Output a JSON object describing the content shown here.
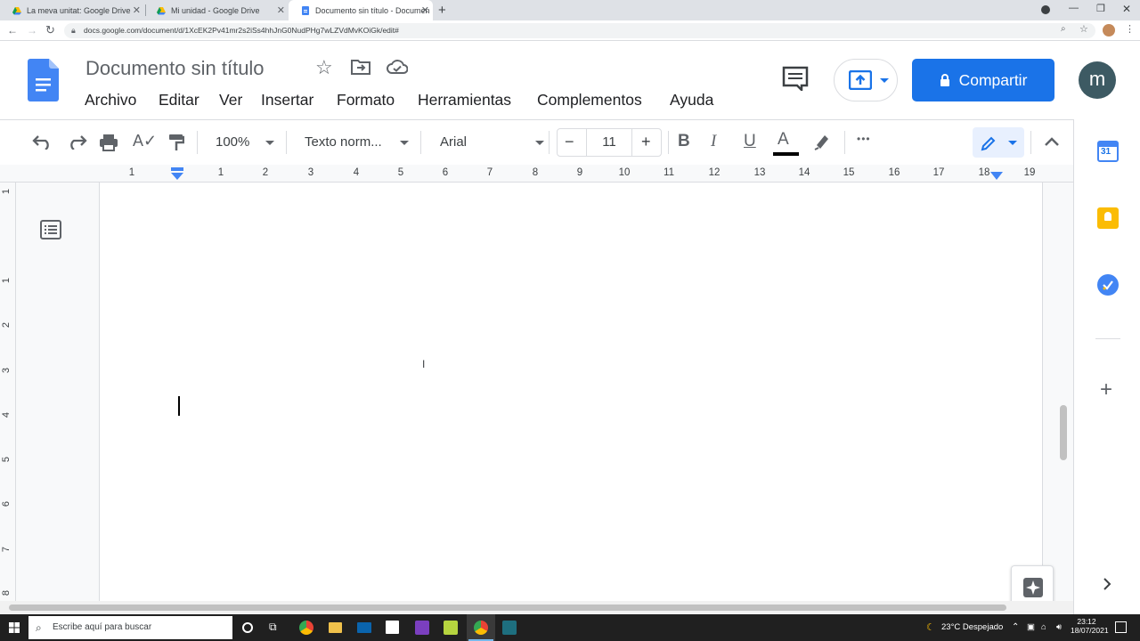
{
  "browser": {
    "tabs": [
      {
        "title": "La meva unitat: Google Drive"
      },
      {
        "title": "Mi unidad - Google Drive"
      },
      {
        "title": "Documento sin título - Documen"
      }
    ],
    "url": "docs.google.com/document/d/1XcEK2Pv41mr2s2iSs4hhJnG0NudPHg7wLZVdMvKOiGk/edit#"
  },
  "doc": {
    "title": "Documento sin título",
    "menu": [
      "Archivo",
      "Editar",
      "Ver",
      "Insertar",
      "Formato",
      "Herramientas",
      "Complementos",
      "Ayuda"
    ],
    "share_label": "Compartir",
    "avatar_letter": "m"
  },
  "toolbar": {
    "zoom": "100%",
    "style": "Texto norm...",
    "font": "Arial",
    "font_size": "11",
    "bold": "B",
    "italic": "I",
    "underline": "U",
    "text_color_letter": "A",
    "more": "•••"
  },
  "ruler": {
    "numbers": [
      "1",
      "1",
      "2",
      "3",
      "4",
      "5",
      "6",
      "7",
      "8",
      "9",
      "10",
      "11",
      "12",
      "13",
      "14",
      "15",
      "16",
      "17",
      "18",
      "19"
    ]
  },
  "vruler": {
    "numbers": [
      "1",
      "1",
      "2",
      "3",
      "4",
      "5",
      "6",
      "7",
      "8"
    ]
  },
  "side": {
    "calendar_day": "31"
  },
  "taskbar": {
    "search_placeholder": "Escribe aquí para buscar",
    "weather": "23°C  Despejado",
    "time": "23:12",
    "date": "18/07/2021"
  },
  "colors": {
    "accent": "#1a73e8",
    "docs_blue": "#4285f4",
    "avatar": "#3d5a63",
    "keep_yellow": "#fbbc04"
  }
}
